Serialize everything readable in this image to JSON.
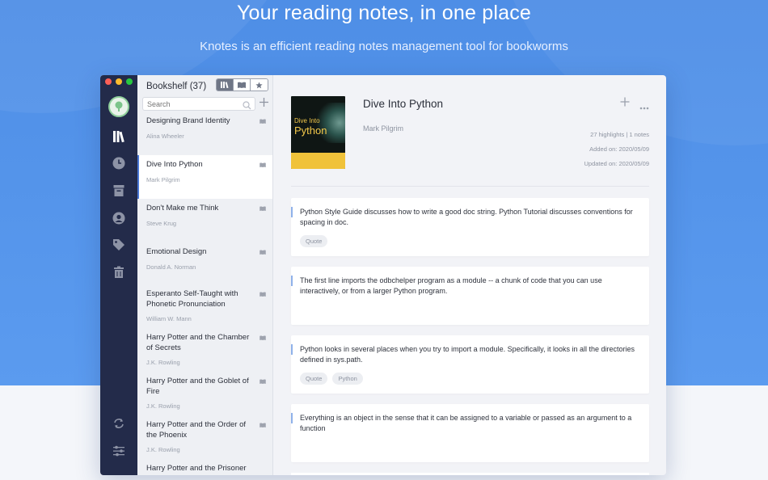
{
  "hero": {
    "title": "Your reading notes, in one place",
    "subtitle": "Knotes is an efficient reading notes management tool for bookworms"
  },
  "rail": {
    "icons": [
      "library-icon",
      "clock-icon",
      "archive-icon",
      "user-circle-icon",
      "tag-icon",
      "trash-icon",
      "sync-icon",
      "sliders-icon"
    ]
  },
  "bookshelf": {
    "title": "Bookshelf (37)",
    "search_placeholder": "Search",
    "books": [
      {
        "title": "Designing Brand Identity",
        "author": "Alina Wheeler"
      },
      {
        "title": "Dive Into Python",
        "author": "Mark Pilgrim"
      },
      {
        "title": "Don't Make me Think",
        "author": "Steve Krug"
      },
      {
        "title": "Emotional Design",
        "author": "Donald A. Norman"
      },
      {
        "title": "Esperanto Self-Taught with Phonetic Pronunciation",
        "author": "William W. Mann"
      },
      {
        "title": "Harry Potter and the Chamber of Secrets",
        "author": "J.K. Rowling"
      },
      {
        "title": "Harry Potter and the Goblet of Fire",
        "author": "J.K. Rowling"
      },
      {
        "title": "Harry Potter and the Order of the Phoenix",
        "author": "J.K. Rowling"
      },
      {
        "title": "Harry Potter and the Prisoner of",
        "author": ""
      }
    ],
    "active_index": 1
  },
  "detail": {
    "title": "Dive Into Python",
    "author": "Mark Pilgrim",
    "highlights": "27 highlights | 1 notes",
    "added": "Added on: 2020/05/09",
    "updated": "Updated on: 2020/05/09",
    "cover": {
      "line1": "Dive Into",
      "line2": "Python"
    },
    "notes": [
      {
        "text": "Python Style Guide discusses how to write a good doc string. Python Tutorial discusses conventions for spacing in doc.",
        "tags": [
          "Quote"
        ]
      },
      {
        "text": "The first line imports the odbchelper program as a module -- a chunk of code that you can use interactively, or from a larger Python program.",
        "tags": []
      },
      {
        "text": "Python looks in several places when you try to import a module. Specifically, it looks in all the directories defined in sys.path.",
        "tags": [
          "Quote",
          "Python"
        ]
      },
      {
        "text": "Everything is an object in the sense that it can be assigned to a variable or passed as an argument to a function",
        "tags": []
      }
    ]
  },
  "colors": {
    "accent": "#4b79d6",
    "rail": "#232b4a",
    "hero": "#5b9bef"
  }
}
